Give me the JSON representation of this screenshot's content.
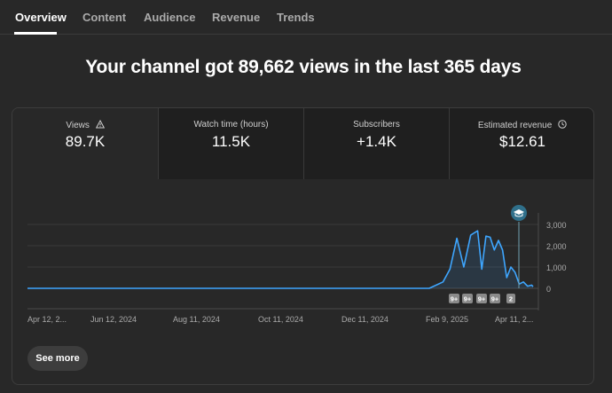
{
  "tabs": [
    "Overview",
    "Content",
    "Audience",
    "Revenue",
    "Trends"
  ],
  "headline": "Your channel got 89,662 views in the last 365 days",
  "metrics": [
    {
      "label": "Views",
      "value": "89.7K",
      "icon": "warning-icon"
    },
    {
      "label": "Watch time (hours)",
      "value": "11.5K"
    },
    {
      "label": "Subscribers",
      "value": "+1.4K"
    },
    {
      "label": "Estimated revenue",
      "value": "$12.61",
      "icon": "clock-icon"
    }
  ],
  "see_more_label": "See more",
  "colors": {
    "line": "#3ea6ff",
    "accent_marker": "#2f6f8a"
  },
  "chart_data": {
    "type": "line",
    "series": [
      {
        "x_days_from_start": [
          0,
          290,
          300,
          305,
          310,
          315,
          320,
          325,
          328,
          331,
          334,
          337,
          340,
          343,
          346,
          349,
          352,
          355,
          358,
          361,
          364,
          365
        ],
        "values": [
          0,
          0,
          300,
          900,
          2350,
          1000,
          2500,
          2700,
          900,
          2450,
          2400,
          1800,
          2250,
          1800,
          500,
          1000,
          750,
          200,
          300,
          100,
          150,
          80
        ]
      }
    ],
    "x_tick_labels": [
      "Apr 12, 2...",
      "Jun 12, 2024",
      "Aug 11, 2024",
      "Oct 11, 2024",
      "Dec 11, 2024",
      "Feb 9, 2025",
      "Apr 11, 2..."
    ],
    "y_tick_labels": [
      "3,000",
      "2,000",
      "1,000",
      "0"
    ],
    "ylim": [
      0,
      3000
    ],
    "grid": true,
    "annotations": [
      "9+",
      "9+",
      "9+",
      "9+",
      "2"
    ]
  }
}
